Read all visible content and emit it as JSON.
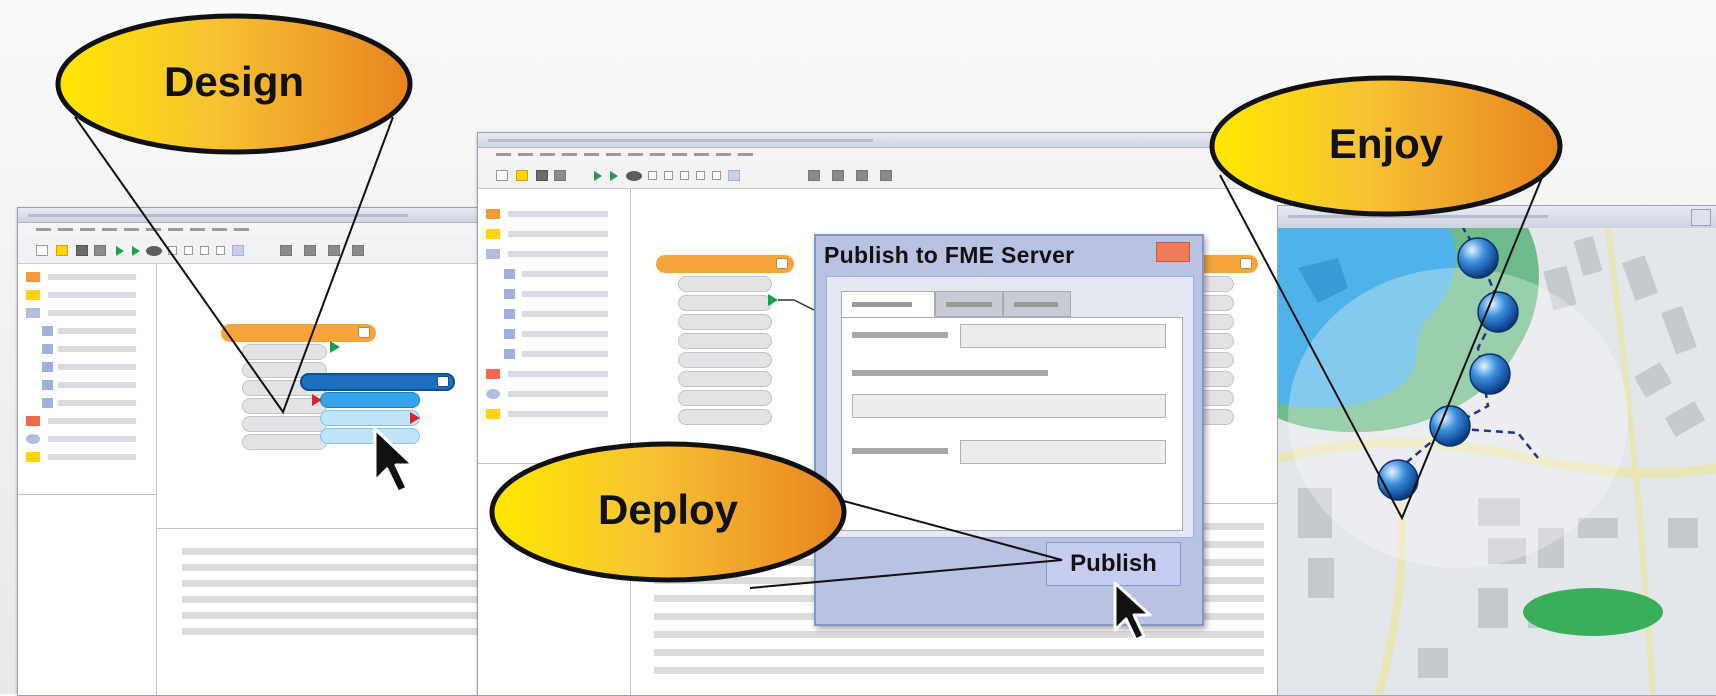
{
  "bubbles": {
    "design": "Design",
    "deploy": "Deploy",
    "enjoy": "Enjoy"
  },
  "dialog": {
    "title": "Publish to FME Server",
    "publish_label": "Publish"
  },
  "colors": {
    "bubble_yellow": "#ffe800",
    "bubble_orange": "#e8841f",
    "node_orange": "#f6a53a",
    "node_blue": "#1e6fc0",
    "dialog_frame": "#b9c2e3",
    "close_button": "#ee7a59",
    "map_water": "#4fb3e9",
    "map_green": "#46b86a"
  },
  "icons": {
    "cursor": "arrow-cursor-icon",
    "location_marker": "location-pin-icon",
    "close": "close-icon"
  }
}
